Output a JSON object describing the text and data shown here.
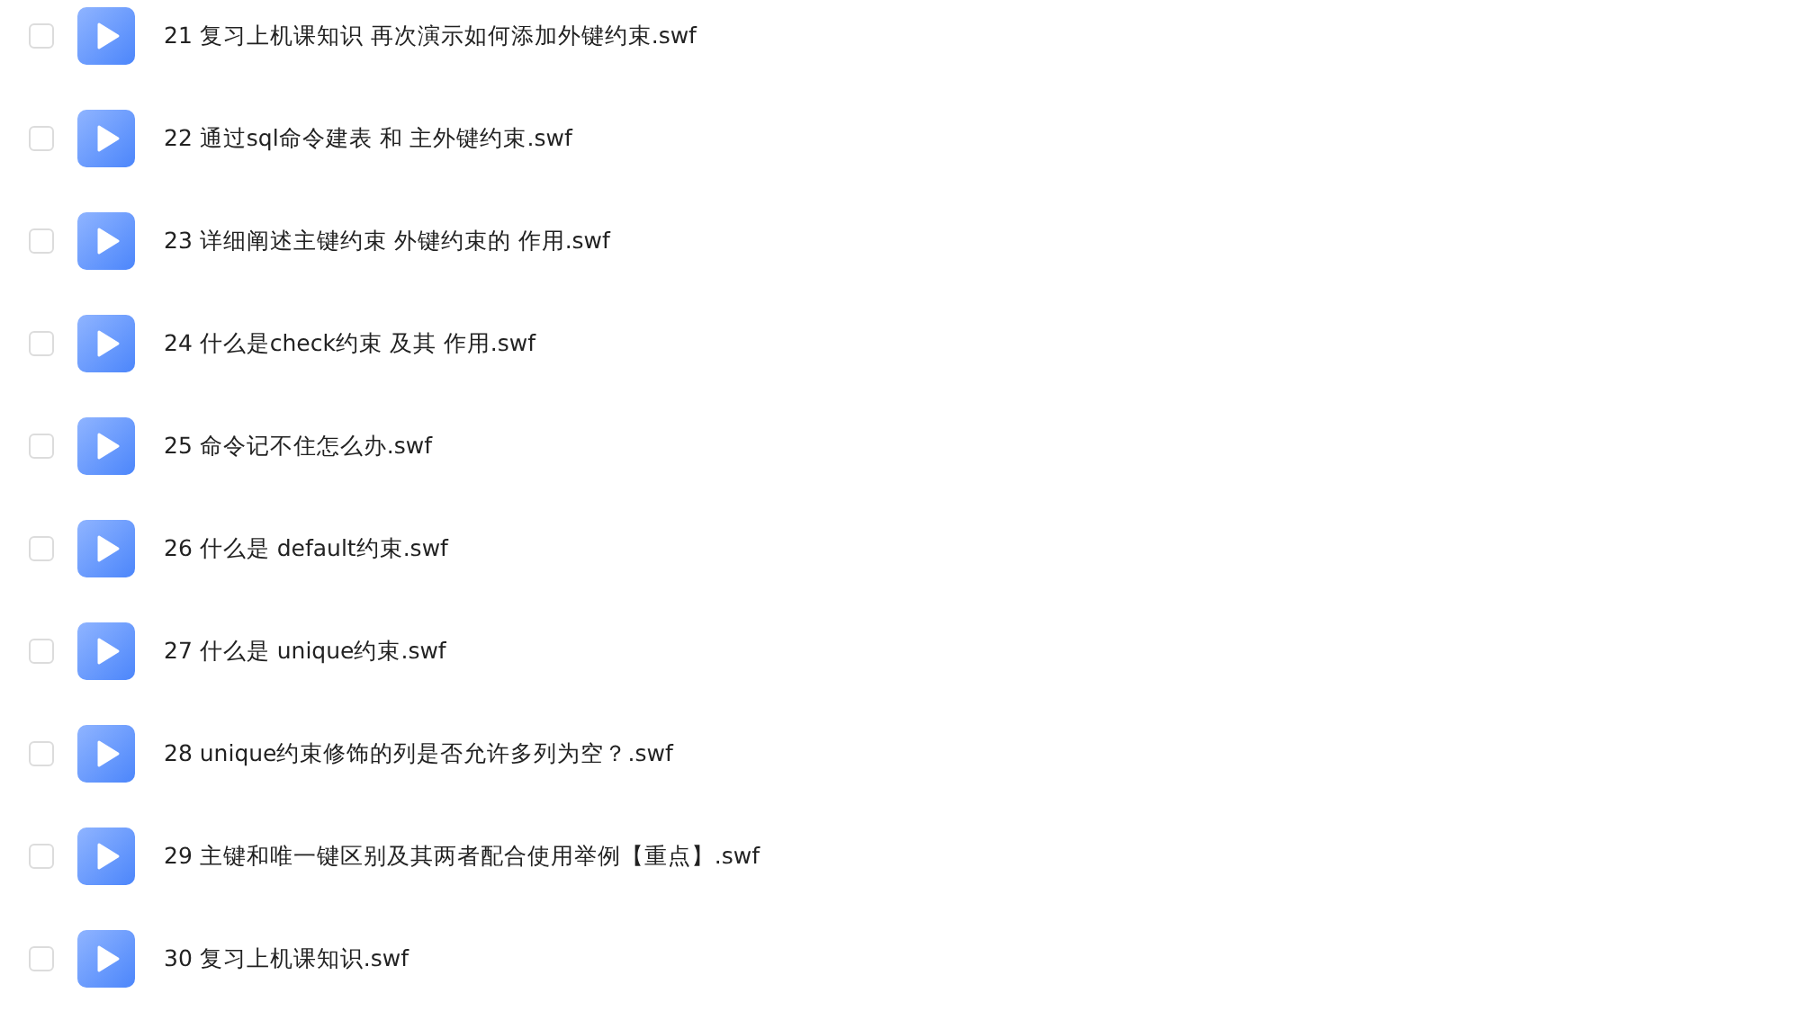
{
  "files": [
    {
      "name": "21 复习上机课知识 再次演示如何添加外键约束.swf",
      "checked": false
    },
    {
      "name": "22 通过sql命令建表 和 主外键约束.swf",
      "checked": false
    },
    {
      "name": "23 详细阐述主键约束 外键约束的 作用.swf",
      "checked": false
    },
    {
      "name": "24 什么是check约束 及其 作用.swf",
      "checked": false
    },
    {
      "name": "25 命令记不住怎么办.swf",
      "checked": false
    },
    {
      "name": "26 什么是 default约束.swf",
      "checked": false
    },
    {
      "name": "27 什么是 unique约束.swf",
      "checked": false
    },
    {
      "name": "28 unique约束修饰的列是否允许多列为空？.swf",
      "checked": false
    },
    {
      "name": "29 主键和唯一键区别及其两者配合使用举例【重点】.swf",
      "checked": false
    },
    {
      "name": "30 复习上机课知识.swf",
      "checked": false
    }
  ]
}
